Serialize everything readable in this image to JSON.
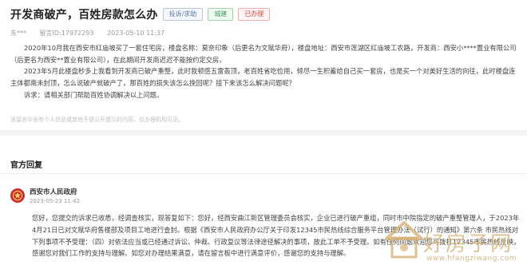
{
  "post": {
    "title": "开发商破产，百姓房款怎么办",
    "tags": [
      "投诉/求助",
      "城建",
      "已办理"
    ],
    "author": "东***",
    "message_no": "留言ID:17972293",
    "datetime": "2023-05-10 11:37",
    "paragraphs": [
      "2020年10月我在西安市红庙坡买了一套住宅房，楼盘名称：莫奈印象（后更名为文赋华府），楼盘地址：西安市莲湖区红庙坡工农路，开发商：西安小****置业有限公司（后更名为西安**置业有限公司），在此期间开发商迟迟不能按约定交房。",
      "2023年5月此楼盘秒多上我看到开发商已破产重整，此时我顿感五雷轰顶，老百姓省吃俭用，倾尽一生积蓄给自己买一套房，也是买一个对美好生活的向往，此时楼盘连主体都南未封顶，怎么说破产就破产了，那百姓的损失该怎么挽回呢？接下来该怎么解决问题呢？"
    ],
    "appeal": "诉求：请相关部门帮助百姓协调解决以上问题。",
    "disclaimer": "该留言中含有个人信息或其他不便公开提示的内容，仅办理机构可见。"
  },
  "reply": {
    "header": "官方回复",
    "org": "西安市人民政府",
    "time": "2023-05-23 11:42",
    "text": "您好，您提交的诉求已收悉，经调查核实，现答复如下：您好，经西安曲江新区管理委员会核实，企业已进行破产重组，同时市中院指定的破产重整管理人，于2023年4月21日已对文赋华府售楼部及项目工地进行查封。根据《西安市人民政府办公厅关于印发12345市民热线综合服务平台管理办法（试行）的通知》第六条 市民热线对下列事项不予受理：（四）对依法应当或已经通过诉讼、仲裁、行政复议等法律途径解决的事项，故此工单不予受理。如有任何问题欢迎您可拨打12345市民热线反映，感谢您对我们工作的支持与理解。如您对办理结果满意，请在留言板中进行满意评价，感谢您的支持与理解。"
  },
  "watermark": {
    "name": "好房子网",
    "url": "www.hfangziwang.com"
  },
  "colors": {
    "status_red": "#d9443d",
    "area_green": "#3f9b57",
    "type_blue": "#5d7aa8",
    "gov_red": "#c8302b"
  }
}
